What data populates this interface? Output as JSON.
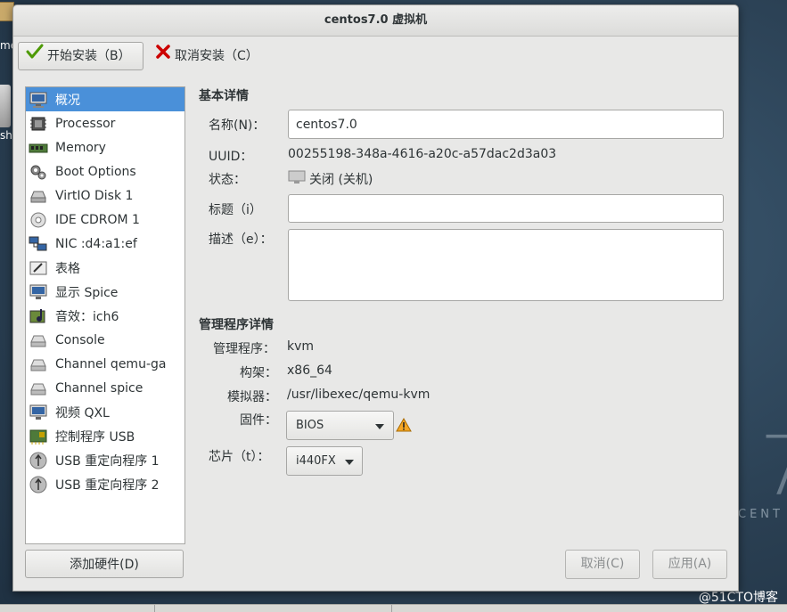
{
  "window": {
    "title": "centos7.0 虚拟机"
  },
  "toolbar": {
    "start_install": "开始安装（B）",
    "cancel_install": "取消安装（C）"
  },
  "sidebar": {
    "items": [
      {
        "label": "概况",
        "icon": "overview-monitor-icon"
      },
      {
        "label": "Processor",
        "icon": "processor-icon"
      },
      {
        "label": "Memory",
        "icon": "memory-icon"
      },
      {
        "label": "Boot Options",
        "icon": "boot-options-gear-icon"
      },
      {
        "label": "VirtIO Disk 1",
        "icon": "disk-icon"
      },
      {
        "label": "IDE CDROM 1",
        "icon": "cdrom-icon"
      },
      {
        "label": "NIC :d4:a1:ef",
        "icon": "network-icon"
      },
      {
        "label": "表格",
        "icon": "tablet-icon"
      },
      {
        "label": "显示 Spice",
        "icon": "display-icon"
      },
      {
        "label": "音效：ich6",
        "icon": "sound-card-icon"
      },
      {
        "label": "Console",
        "icon": "serial-console-icon"
      },
      {
        "label": "Channel qemu-ga",
        "icon": "channel-icon"
      },
      {
        "label": "Channel spice",
        "icon": "channel-icon"
      },
      {
        "label": "视频 QXL",
        "icon": "video-monitor-icon"
      },
      {
        "label": "控制程序 USB",
        "icon": "controller-card-icon"
      },
      {
        "label": "USB 重定向程序 1",
        "icon": "usb-redirect-icon"
      },
      {
        "label": "USB 重定向程序 2",
        "icon": "usb-redirect-icon"
      }
    ],
    "add_hardware": "添加硬件(D)"
  },
  "basic": {
    "section_title": "基本详情",
    "name_label": "名称(N)：",
    "name_value": "centos7.0",
    "uuid_label": "UUID：",
    "uuid_value": "00255198-348a-4616-a20c-a57dac2d3a03",
    "status_label": "状态：",
    "status_value": "关闭 (关机)",
    "title_label": "标题（i）",
    "title_value": "",
    "desc_label": "描述（e）：",
    "desc_value": ""
  },
  "hypervisor": {
    "section_title": "管理程序详情",
    "hypervisor_label": "管理程序：",
    "hypervisor_value": "kvm",
    "arch_label": "构架：",
    "arch_value": "x86_64",
    "emulator_label": "模拟器：",
    "emulator_value": "/usr/libexec/qemu-kvm",
    "firmware_label": "固件：",
    "firmware_value": "BIOS",
    "chipset_label": "芯片（t）：",
    "chipset_value": "i440FX"
  },
  "footer": {
    "cancel": "取消(C)",
    "apply": "应用(A)"
  },
  "desktop": {
    "label_top": "me",
    "label_trash": "sh",
    "wallpaper_number": "7",
    "wallpaper_word": "CENT",
    "watermark": "@51CTO博客"
  },
  "colors": {
    "selection": "#4a90d9",
    "warning": "#f5a623",
    "window_bg": "#e8e8e7"
  }
}
